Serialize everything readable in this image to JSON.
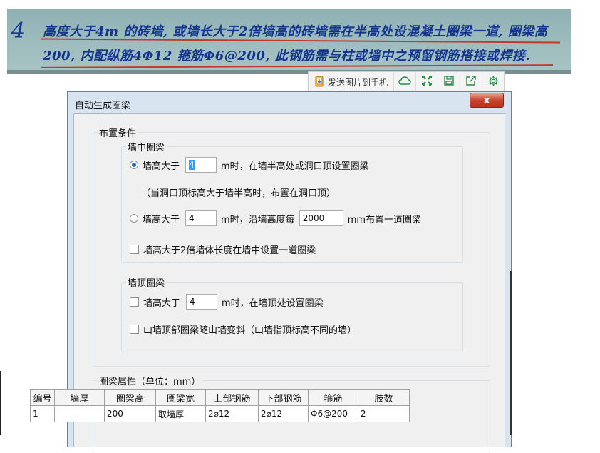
{
  "photo": {
    "line1": "高度大于4m 的砖墙, 或墙长大于2倍墙高的砖墙需在半高处设混凝土圈梁一道, 圈梁高",
    "line2": "200, 内配纵筋4Φ12 箍筋Φ6@200, 此钢筋需与柱或墙中之预留钢筋搭接或焊接."
  },
  "toolbar": {
    "send_label": "发送图片到手机",
    "icons": [
      "phone-send-icon",
      "cloud-icon",
      "expand-icon",
      "save-icon",
      "share-icon",
      "gear-icon"
    ],
    "colors": {
      "cloud": "#2a8a4a",
      "expand": "#1f9a3a",
      "save": "#2a8a4a",
      "share": "#2a8a4a",
      "gear": "#2a8a4a"
    }
  },
  "dialog": {
    "title": "自动生成圈梁",
    "close_label": "x",
    "layout_group": "布置条件",
    "mid_group": {
      "legend": "墙中圈梁",
      "opt1_prefix": "墙高大于",
      "opt1_value": "4",
      "opt1_suffix": "m时，在墙半高处或洞口顶设置圈梁",
      "note": "（当洞口顶标高大于墙半高时，布置在洞口顶）",
      "opt2_prefix": "墙高大于",
      "opt2_value": "4",
      "opt2_mid": "m时，沿墙高度每",
      "opt2_value2": "2000",
      "opt2_suffix": "mm布置一道圈梁",
      "check_label": "墙高大于2倍墙体长度在墙中设置一道圈梁"
    },
    "top_group": {
      "legend": "墙顶圈梁",
      "check1_prefix": "墙高大于",
      "check1_value": "4",
      "check1_suffix": "m时，在墙顶处设置圈梁",
      "check2_label": "山墙顶部圈梁随山墙变斜（山墙指顶标高不同的墙）"
    },
    "props_group": "圈梁属性（单位：mm）",
    "table": {
      "headers": [
        "编号",
        "墙厚",
        "圈梁高",
        "圈梁宽",
        "上部钢筋",
        "下部钢筋",
        "箍筋",
        "肢数"
      ],
      "rows": [
        [
          "1",
          "",
          "200",
          "取墙厚",
          "2⌀12",
          "2⌀12",
          "Φ6@200",
          "2"
        ]
      ]
    }
  }
}
